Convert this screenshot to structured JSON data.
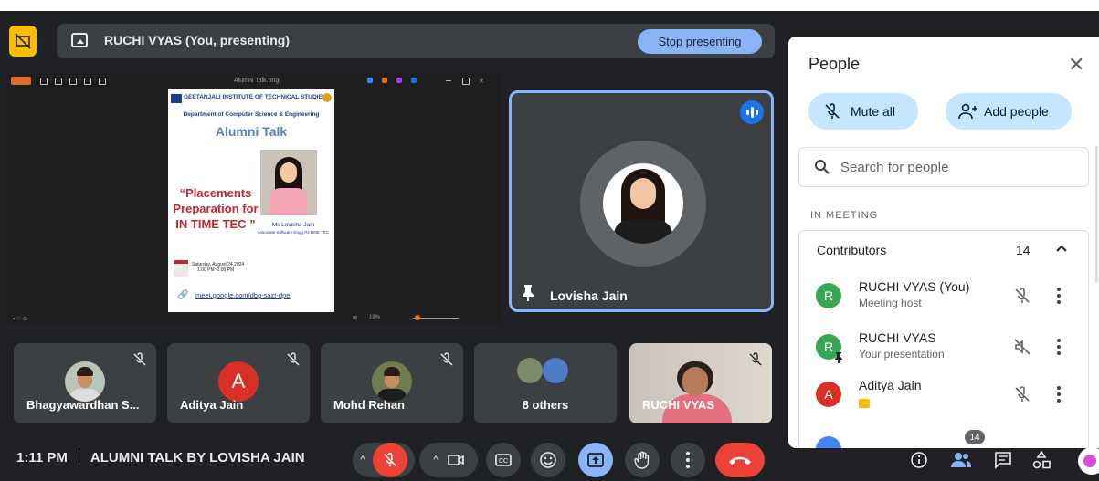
{
  "presenting_bar": {
    "title": "RUCHI VYAS (You, presenting)",
    "stop_label": "Stop presenting"
  },
  "presentation": {
    "file_name": "Alumni Talk.png",
    "zoom": "19%",
    "poster": {
      "institute": "GEETANJALI INSTITUTE OF TECHNICAL STUDIES",
      "department": "Department of Computer Science & Engineering",
      "heading": "Alumni Talk",
      "quote": "“Placements Preparation for IN TIME TEC ”",
      "speaker_name": "Ms Lovisha Jain",
      "speaker_role": "Associate Software Engg IN-TIME TEC",
      "date": "Saturday, August 24,2024",
      "time": "1:00 PM~2:00 PM",
      "link": "meet.google.com/dbg-sazt-dpe"
    }
  },
  "speaker_tile": {
    "name": "Lovisha Jain"
  },
  "tiles": [
    {
      "name": "Bhagyawardhan S..."
    },
    {
      "name": "Aditya Jain",
      "initial": "A"
    },
    {
      "name": "Mohd Rehan"
    },
    {
      "name": "8 others"
    },
    {
      "name": "RUCHI VYAS"
    }
  ],
  "bottom_bar": {
    "time": "1:11 PM",
    "meeting_title": "ALUMNI TALK BY LOVISHA JAIN",
    "people_count": "14"
  },
  "people_panel": {
    "title": "People",
    "mute_all": "Mute all",
    "add_people": "Add people",
    "search_placeholder": "Search for people",
    "section": "IN MEETING",
    "group_label": "Contributors",
    "group_count": "14",
    "participants": [
      {
        "initial": "R",
        "name": "RUCHI VYAS (You)",
        "role": "Meeting host",
        "color": "#34a853"
      },
      {
        "initial": "R",
        "name": "RUCHI VYAS",
        "role": "Your presentation",
        "color": "#34a853"
      },
      {
        "initial": "A",
        "name": "Aditya Jain",
        "role": "",
        "color": "#d93025"
      }
    ]
  },
  "colors": {
    "accent": "#8ab4f8",
    "end_call": "#ea4335",
    "background": "#202124"
  }
}
